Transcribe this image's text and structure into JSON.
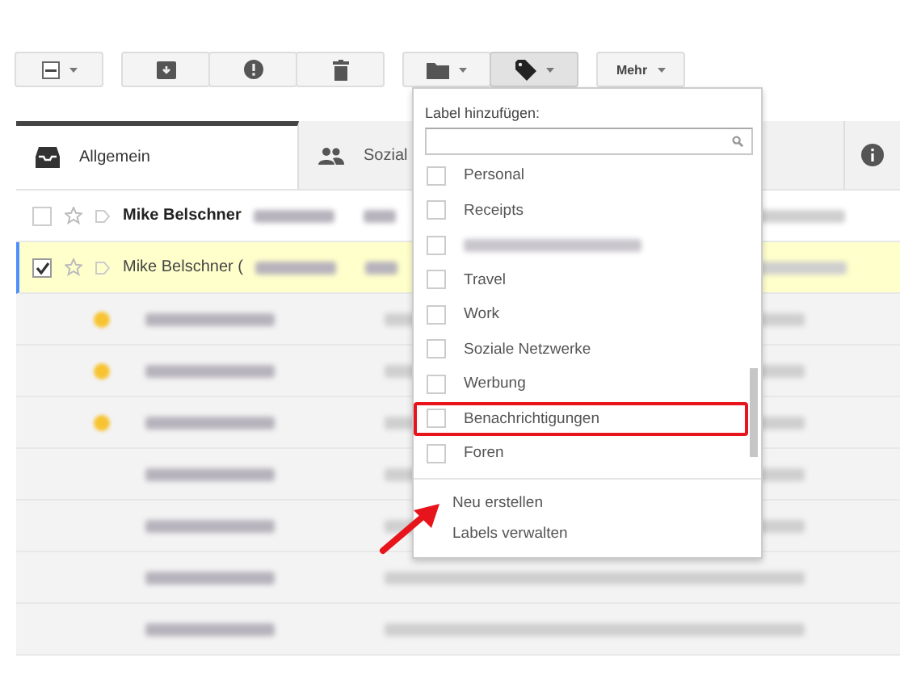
{
  "toolbar": {
    "more_label": "Mehr"
  },
  "tabs": [
    {
      "label": "Allgemein",
      "selected": true
    },
    {
      "label": "Sozial",
      "selected": false
    },
    {
      "selected": false
    }
  ],
  "messages": [
    {
      "kind": "message",
      "sender": "Mike Belschner",
      "unread": true,
      "checked": false,
      "selected": false
    },
    {
      "kind": "message",
      "sender": "Mike Belschner (",
      "unread": false,
      "checked": true,
      "selected": true
    },
    {
      "kind": "blurred",
      "starred": true
    },
    {
      "kind": "blurred",
      "starred": true
    },
    {
      "kind": "blurred",
      "starred": true
    },
    {
      "kind": "blurred",
      "starred": false
    },
    {
      "kind": "blurred",
      "starred": false
    },
    {
      "kind": "blurred",
      "starred": false
    },
    {
      "kind": "blurred",
      "starred": false
    }
  ],
  "label_menu": {
    "title": "Label hinzufügen:",
    "items": [
      {
        "kind": "label",
        "label": "Personal",
        "checked": false,
        "highlighted": false
      },
      {
        "kind": "label",
        "label": "Receipts",
        "checked": false,
        "highlighted": false
      },
      {
        "kind": "blurred",
        "checked": false,
        "highlighted": false
      },
      {
        "kind": "label",
        "label": "Travel",
        "checked": false,
        "highlighted": false
      },
      {
        "kind": "label",
        "label": "Work",
        "checked": false,
        "highlighted": false
      },
      {
        "kind": "label",
        "label": "Soziale Netzwerke",
        "checked": false,
        "highlighted": false
      },
      {
        "kind": "label",
        "label": "Werbung",
        "checked": false,
        "highlighted": false
      },
      {
        "kind": "label",
        "label": "Benachrichtigungen",
        "checked": false,
        "highlighted": true
      },
      {
        "kind": "label",
        "label": "Foren",
        "checked": false,
        "highlighted": false
      }
    ],
    "actions": [
      "Neu erstellen",
      "Labels verwalten"
    ]
  }
}
